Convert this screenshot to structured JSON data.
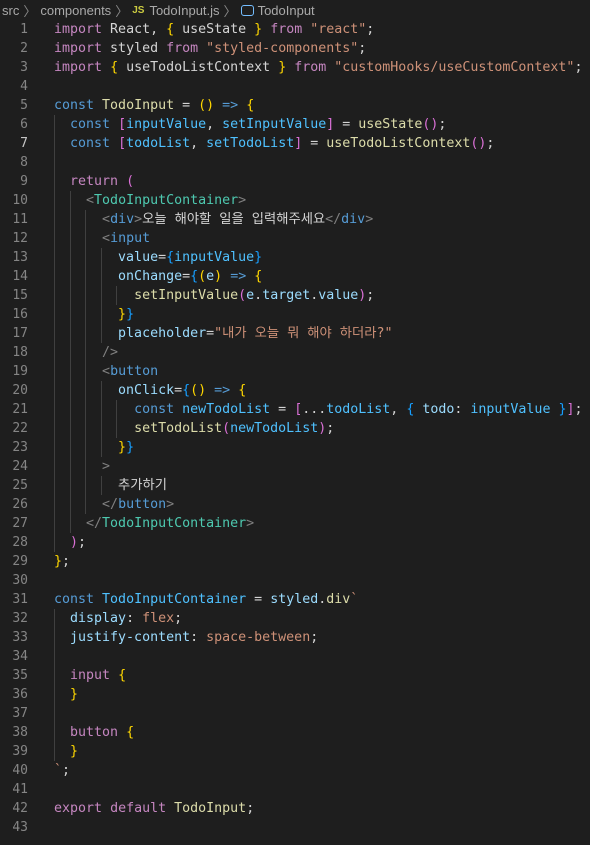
{
  "breadcrumb": {
    "items": [
      {
        "label": "src",
        "type": "folder"
      },
      {
        "label": "components",
        "type": "folder"
      },
      {
        "label": "TodoInput.js",
        "type": "file",
        "icon": "js-file-icon"
      },
      {
        "label": "TodoInput",
        "type": "symbol",
        "icon": "symbol-variable-icon"
      }
    ],
    "separator": "〉"
  },
  "editor": {
    "current_line": 7,
    "colors": {
      "background": "#1e1e1e",
      "keyword": "#c586c0",
      "storage": "#569cd6",
      "variable": "#9cdcfe",
      "constant": "#4fc1ff",
      "function": "#dcdcaa",
      "string": "#ce9178",
      "tag": "#4ec9b0",
      "bracket_1": "#ffd700",
      "bracket_2": "#da70d6",
      "bracket_3": "#179fff"
    },
    "lines": [
      {
        "n": "1",
        "tokens": [
          [
            "kw",
            "import"
          ],
          [
            "pu",
            " React, "
          ],
          [
            "b1",
            "{"
          ],
          [
            "pu",
            " useState "
          ],
          [
            "b1",
            "}"
          ],
          [
            "pu",
            " "
          ],
          [
            "kw",
            "from"
          ],
          [
            "pu",
            " "
          ],
          [
            "str",
            "\"react\""
          ],
          [
            "pu",
            ";"
          ]
        ]
      },
      {
        "n": "2",
        "tokens": [
          [
            "kw",
            "import"
          ],
          [
            "pu",
            " styled "
          ],
          [
            "kw",
            "from"
          ],
          [
            "pu",
            " "
          ],
          [
            "str",
            "\"styled-components\""
          ],
          [
            "pu",
            ";"
          ]
        ]
      },
      {
        "n": "3",
        "tokens": [
          [
            "kw",
            "import"
          ],
          [
            "pu",
            " "
          ],
          [
            "b1",
            "{"
          ],
          [
            "pu",
            " useTodoListContext "
          ],
          [
            "b1",
            "}"
          ],
          [
            "pu",
            " "
          ],
          [
            "kw",
            "from"
          ],
          [
            "pu",
            " "
          ],
          [
            "str",
            "\"customHooks/useCustomContext\""
          ],
          [
            "pu",
            ";"
          ]
        ]
      },
      {
        "n": "4",
        "tokens": []
      },
      {
        "n": "5",
        "tokens": [
          [
            "st",
            "const"
          ],
          [
            "pu",
            " "
          ],
          [
            "fn",
            "TodoInput"
          ],
          [
            "pu",
            " = "
          ],
          [
            "b1",
            "()"
          ],
          [
            "pu",
            " "
          ],
          [
            "st",
            "=>"
          ],
          [
            "pu",
            " "
          ],
          [
            "b1",
            "{"
          ]
        ]
      },
      {
        "n": "6",
        "tokens": [
          [
            "pu",
            "  "
          ],
          [
            "st",
            "const"
          ],
          [
            "pu",
            " "
          ],
          [
            "b2",
            "["
          ],
          [
            "cst",
            "inputValue"
          ],
          [
            "pu",
            ", "
          ],
          [
            "cst",
            "setInputValue"
          ],
          [
            "b2",
            "]"
          ],
          [
            "pu",
            " = "
          ],
          [
            "fn",
            "useState"
          ],
          [
            "b2",
            "()"
          ],
          [
            "pu",
            ";"
          ]
        ]
      },
      {
        "n": "7",
        "tokens": [
          [
            "pu",
            "  "
          ],
          [
            "st",
            "const"
          ],
          [
            "pu",
            " "
          ],
          [
            "b2",
            "["
          ],
          [
            "cst",
            "todoList"
          ],
          [
            "pu",
            ", "
          ],
          [
            "cst",
            "setTodoList"
          ],
          [
            "b2",
            "]"
          ],
          [
            "pu",
            " = "
          ],
          [
            "fn",
            "useTodoListContext"
          ],
          [
            "b2",
            "()"
          ],
          [
            "pu",
            ";"
          ]
        ]
      },
      {
        "n": "8",
        "tokens": []
      },
      {
        "n": "9",
        "tokens": [
          [
            "pu",
            "  "
          ],
          [
            "kw",
            "return"
          ],
          [
            "pu",
            " "
          ],
          [
            "b2",
            "("
          ]
        ]
      },
      {
        "n": "10",
        "tokens": [
          [
            "pu",
            "    "
          ],
          [
            "gt",
            "<"
          ],
          [
            "tag",
            "TodoInputContainer"
          ],
          [
            "gt",
            ">"
          ]
        ]
      },
      {
        "n": "11",
        "tokens": [
          [
            "pu",
            "      "
          ],
          [
            "gt",
            "<"
          ],
          [
            "hb",
            "div"
          ],
          [
            "gt",
            ">"
          ],
          [
            "txt",
            "오늘 해야할 일을 입력해주세요"
          ],
          [
            "gt",
            "</"
          ],
          [
            "hb",
            "div"
          ],
          [
            "gt",
            ">"
          ]
        ]
      },
      {
        "n": "12",
        "tokens": [
          [
            "pu",
            "      "
          ],
          [
            "gt",
            "<"
          ],
          [
            "hb",
            "input"
          ]
        ]
      },
      {
        "n": "13",
        "tokens": [
          [
            "pu",
            "        "
          ],
          [
            "var",
            "value"
          ],
          [
            "pu",
            "="
          ],
          [
            "b3",
            "{"
          ],
          [
            "cst",
            "inputValue"
          ],
          [
            "b3",
            "}"
          ]
        ]
      },
      {
        "n": "14",
        "tokens": [
          [
            "pu",
            "        "
          ],
          [
            "var",
            "onChange"
          ],
          [
            "pu",
            "="
          ],
          [
            "b3",
            "{"
          ],
          [
            "b1",
            "("
          ],
          [
            "var",
            "e"
          ],
          [
            "b1",
            ")"
          ],
          [
            "pu",
            " "
          ],
          [
            "st",
            "=>"
          ],
          [
            "pu",
            " "
          ],
          [
            "b1",
            "{"
          ]
        ]
      },
      {
        "n": "15",
        "tokens": [
          [
            "pu",
            "          "
          ],
          [
            "fn",
            "setInputValue"
          ],
          [
            "b2",
            "("
          ],
          [
            "var",
            "e"
          ],
          [
            "pu",
            "."
          ],
          [
            "var",
            "target"
          ],
          [
            "pu",
            "."
          ],
          [
            "var",
            "value"
          ],
          [
            "b2",
            ")"
          ],
          [
            "pu",
            ";"
          ]
        ]
      },
      {
        "n": "16",
        "tokens": [
          [
            "pu",
            "        "
          ],
          [
            "b1",
            "}"
          ],
          [
            "b3",
            "}"
          ]
        ]
      },
      {
        "n": "17",
        "tokens": [
          [
            "pu",
            "        "
          ],
          [
            "var",
            "placeholder"
          ],
          [
            "pu",
            "="
          ],
          [
            "str",
            "\"내가 오늘 뭐 해야 하더라?\""
          ]
        ]
      },
      {
        "n": "18",
        "tokens": [
          [
            "pu",
            "      "
          ],
          [
            "gt",
            "/>"
          ]
        ]
      },
      {
        "n": "19",
        "tokens": [
          [
            "pu",
            "      "
          ],
          [
            "gt",
            "<"
          ],
          [
            "hb",
            "button"
          ]
        ]
      },
      {
        "n": "20",
        "tokens": [
          [
            "pu",
            "        "
          ],
          [
            "var",
            "onClick"
          ],
          [
            "pu",
            "="
          ],
          [
            "b3",
            "{"
          ],
          [
            "b1",
            "()"
          ],
          [
            "pu",
            " "
          ],
          [
            "st",
            "=>"
          ],
          [
            "pu",
            " "
          ],
          [
            "b1",
            "{"
          ]
        ]
      },
      {
        "n": "21",
        "tokens": [
          [
            "pu",
            "          "
          ],
          [
            "st",
            "const"
          ],
          [
            "pu",
            " "
          ],
          [
            "cst",
            "newTodoList"
          ],
          [
            "pu",
            " = "
          ],
          [
            "b2",
            "["
          ],
          [
            "pu",
            "..."
          ],
          [
            "cst",
            "todoList"
          ],
          [
            "pu",
            ", "
          ],
          [
            "b3",
            "{"
          ],
          [
            "pu",
            " "
          ],
          [
            "var",
            "todo"
          ],
          [
            "pu",
            ": "
          ],
          [
            "cst",
            "inputValue"
          ],
          [
            "pu",
            " "
          ],
          [
            "b3",
            "}"
          ],
          [
            "b2",
            "]"
          ],
          [
            "pu",
            ";"
          ]
        ]
      },
      {
        "n": "22",
        "tokens": [
          [
            "pu",
            "          "
          ],
          [
            "fn",
            "setTodoList"
          ],
          [
            "b2",
            "("
          ],
          [
            "cst",
            "newTodoList"
          ],
          [
            "b2",
            ")"
          ],
          [
            "pu",
            ";"
          ]
        ]
      },
      {
        "n": "23",
        "tokens": [
          [
            "pu",
            "        "
          ],
          [
            "b1",
            "}"
          ],
          [
            "b3",
            "}"
          ]
        ]
      },
      {
        "n": "24",
        "tokens": [
          [
            "pu",
            "      "
          ],
          [
            "gt",
            ">"
          ]
        ]
      },
      {
        "n": "25",
        "tokens": [
          [
            "pu",
            "        "
          ],
          [
            "txt",
            "추가하기"
          ]
        ]
      },
      {
        "n": "26",
        "tokens": [
          [
            "pu",
            "      "
          ],
          [
            "gt",
            "</"
          ],
          [
            "hb",
            "button"
          ],
          [
            "gt",
            ">"
          ]
        ]
      },
      {
        "n": "27",
        "tokens": [
          [
            "pu",
            "    "
          ],
          [
            "gt",
            "</"
          ],
          [
            "tag",
            "TodoInputContainer"
          ],
          [
            "gt",
            ">"
          ]
        ]
      },
      {
        "n": "28",
        "tokens": [
          [
            "pu",
            "  "
          ],
          [
            "b2",
            ")"
          ],
          [
            "pu",
            ";"
          ]
        ]
      },
      {
        "n": "29",
        "tokens": [
          [
            "b1",
            "}"
          ],
          [
            "pu",
            ";"
          ]
        ]
      },
      {
        "n": "30",
        "tokens": []
      },
      {
        "n": "31",
        "tokens": [
          [
            "st",
            "const"
          ],
          [
            "pu",
            " "
          ],
          [
            "cst",
            "TodoInputContainer"
          ],
          [
            "pu",
            " = "
          ],
          [
            "var",
            "styled"
          ],
          [
            "pu",
            "."
          ],
          [
            "fn",
            "div"
          ],
          [
            "str",
            "`"
          ]
        ]
      },
      {
        "n": "32",
        "tokens": [
          [
            "pu",
            "  "
          ],
          [
            "var",
            "display"
          ],
          [
            "pu",
            ": "
          ],
          [
            "str",
            "flex"
          ],
          [
            "pu",
            ";"
          ]
        ]
      },
      {
        "n": "33",
        "tokens": [
          [
            "pu",
            "  "
          ],
          [
            "var",
            "justify-content"
          ],
          [
            "pu",
            ": "
          ],
          [
            "str",
            "space-between"
          ],
          [
            "pu",
            ";"
          ]
        ]
      },
      {
        "n": "34",
        "tokens": []
      },
      {
        "n": "35",
        "tokens": [
          [
            "pu",
            "  "
          ],
          [
            "kw",
            "input"
          ],
          [
            "pu",
            " "
          ],
          [
            "b1",
            "{"
          ]
        ]
      },
      {
        "n": "36",
        "tokens": [
          [
            "pu",
            "  "
          ],
          [
            "b1",
            "}"
          ]
        ]
      },
      {
        "n": "37",
        "tokens": []
      },
      {
        "n": "38",
        "tokens": [
          [
            "pu",
            "  "
          ],
          [
            "kw",
            "button"
          ],
          [
            "pu",
            " "
          ],
          [
            "b1",
            "{"
          ]
        ]
      },
      {
        "n": "39",
        "tokens": [
          [
            "pu",
            "  "
          ],
          [
            "b1",
            "}"
          ]
        ]
      },
      {
        "n": "40",
        "tokens": [
          [
            "str",
            "`"
          ],
          [
            "pu",
            ";"
          ]
        ]
      },
      {
        "n": "41",
        "tokens": []
      },
      {
        "n": "42",
        "tokens": [
          [
            "kw",
            "export"
          ],
          [
            "pu",
            " "
          ],
          [
            "kw",
            "default"
          ],
          [
            "pu",
            " "
          ],
          [
            "fn",
            "TodoInput"
          ],
          [
            "pu",
            ";"
          ]
        ]
      },
      {
        "n": "43",
        "tokens": []
      }
    ]
  }
}
